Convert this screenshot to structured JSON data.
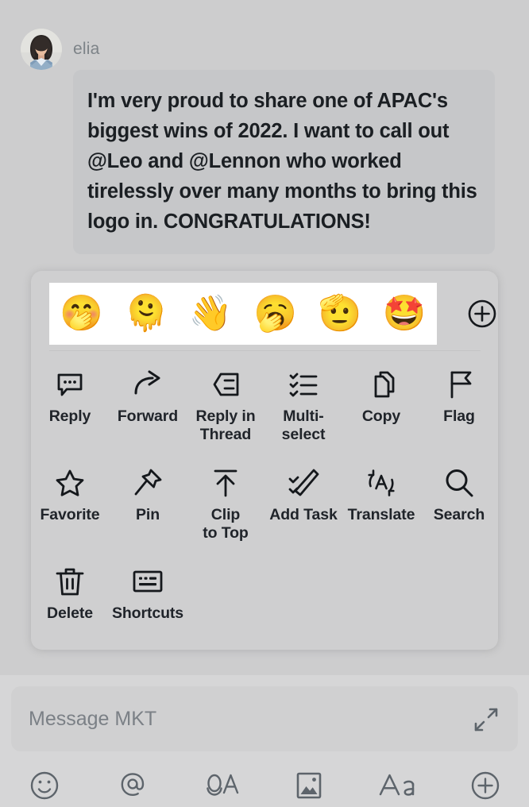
{
  "theme": {
    "background": "#cdcdce",
    "bubble_bg": "#c6c7c9",
    "panel_bg": "#cfcfd0",
    "emoji_strip_bg": "#ffffff",
    "composer_bg": "#d6d6d7",
    "input_bg": "#d0d0d1",
    "icon_color": "#15181c",
    "label_color": "#20242a",
    "muted_text": "#7b8086"
  },
  "message": {
    "sender": "elia",
    "avatar_icon": "user-photo-avatar",
    "text": "I'm very proud to share one of APAC's biggest wins of 2022. I want to call out @Leo and @Lennon who worked tirelessly over many months to bring this logo in. CONGRATULATIONS!",
    "mentions": [
      "@Leo",
      "@Lennon"
    ]
  },
  "context_menu": {
    "emoji_reactions": [
      {
        "name": "face-with-open-eyes-and-hand-over-mouth-emoji",
        "glyph": "🤭"
      },
      {
        "name": "face-with-rolling-eyes-emoji",
        "glyph": "🫠"
      },
      {
        "name": "waving-hand-emoji",
        "glyph": "👋"
      },
      {
        "name": "yawning-face-emoji",
        "glyph": "🥱"
      },
      {
        "name": "saluting-face-emoji",
        "glyph": "🫡"
      },
      {
        "name": "star-struck-emoji",
        "glyph": "🤩"
      }
    ],
    "more_emoji_icon": "plus-circle-icon",
    "actions": [
      {
        "label": "Reply",
        "icon": "reply-bubble-icon"
      },
      {
        "label": "Forward",
        "icon": "forward-arrow-icon"
      },
      {
        "label": "Reply in\nThread",
        "icon": "reply-in-thread-icon"
      },
      {
        "label": "Multi-\nselect",
        "icon": "checklist-icon"
      },
      {
        "label": "Copy",
        "icon": "copy-icon"
      },
      {
        "label": "Flag",
        "icon": "flag-icon"
      },
      {
        "label": "Favorite",
        "icon": "star-icon"
      },
      {
        "label": "Pin",
        "icon": "pushpin-icon"
      },
      {
        "label": "Clip\nto Top",
        "icon": "arrow-up-to-bar-icon"
      },
      {
        "label": "Add Task",
        "icon": "pencil-check-icon"
      },
      {
        "label": "Translate",
        "icon": "translate-a-icon"
      },
      {
        "label": "Search",
        "icon": "magnifier-icon"
      },
      {
        "label": "Delete",
        "icon": "trash-icon"
      },
      {
        "label": "Shortcuts",
        "icon": "keyboard-shortcuts-icon"
      }
    ]
  },
  "composer": {
    "placeholder": "Message MKT",
    "value": "",
    "expand_icon": "expand-diagonal-icon",
    "toolbar": [
      {
        "name": "emoji-picker",
        "icon": "smiley-face-icon"
      },
      {
        "name": "mention",
        "icon": "at-sign-icon"
      },
      {
        "name": "voice-to-text",
        "icon": "voice-to-text-icon"
      },
      {
        "name": "image-attach",
        "icon": "image-icon"
      },
      {
        "name": "text-format",
        "icon": "text-format-aa-icon"
      },
      {
        "name": "more-options",
        "icon": "plus-circle-icon"
      }
    ]
  }
}
